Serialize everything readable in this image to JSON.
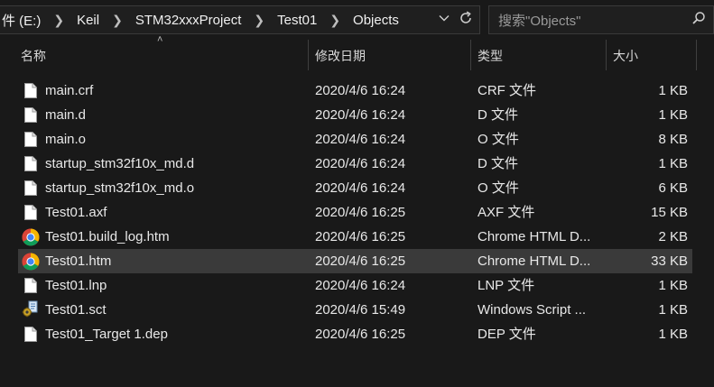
{
  "address": {
    "crumbs": [
      "件 (E:)",
      "Keil",
      "STM32xxxProject",
      "Test01",
      "Objects"
    ],
    "dropdown_icon": "chevron-down-icon",
    "refresh_icon": "refresh-icon"
  },
  "search": {
    "placeholder": "搜索\"Objects\"",
    "icon": "search-icon"
  },
  "columns": {
    "name": "名称",
    "date": "修改日期",
    "type": "类型",
    "size": "大小"
  },
  "files": [
    {
      "name": "main.crf",
      "date": "2020/4/6 16:24",
      "type": "CRF 文件",
      "size": "1 KB",
      "icon": "file-icon"
    },
    {
      "name": "main.d",
      "date": "2020/4/6 16:24",
      "type": "D 文件",
      "size": "1 KB",
      "icon": "file-icon"
    },
    {
      "name": "main.o",
      "date": "2020/4/6 16:24",
      "type": "O 文件",
      "size": "8 KB",
      "icon": "file-icon"
    },
    {
      "name": "startup_stm32f10x_md.d",
      "date": "2020/4/6 16:24",
      "type": "D 文件",
      "size": "1 KB",
      "icon": "file-icon"
    },
    {
      "name": "startup_stm32f10x_md.o",
      "date": "2020/4/6 16:24",
      "type": "O 文件",
      "size": "6 KB",
      "icon": "file-icon"
    },
    {
      "name": "Test01.axf",
      "date": "2020/4/6 16:25",
      "type": "AXF 文件",
      "size": "15 KB",
      "icon": "file-icon"
    },
    {
      "name": "Test01.build_log.htm",
      "date": "2020/4/6 16:25",
      "type": "Chrome HTML D...",
      "size": "2 KB",
      "icon": "chrome-icon"
    },
    {
      "name": "Test01.htm",
      "date": "2020/4/6 16:25",
      "type": "Chrome HTML D...",
      "size": "33 KB",
      "icon": "chrome-icon",
      "selected": true
    },
    {
      "name": "Test01.lnp",
      "date": "2020/4/6 16:24",
      "type": "LNP 文件",
      "size": "1 KB",
      "icon": "file-icon"
    },
    {
      "name": "Test01.sct",
      "date": "2020/4/6 15:49",
      "type": "Windows Script ...",
      "size": "1 KB",
      "icon": "script-icon"
    },
    {
      "name": "Test01_Target 1.dep",
      "date": "2020/4/6 16:25",
      "type": "DEP 文件",
      "size": "1 KB",
      "icon": "file-icon"
    }
  ],
  "colors": {
    "background": "#191919",
    "selected_row": "#3a3a3a",
    "text": "#e8e8e8"
  }
}
